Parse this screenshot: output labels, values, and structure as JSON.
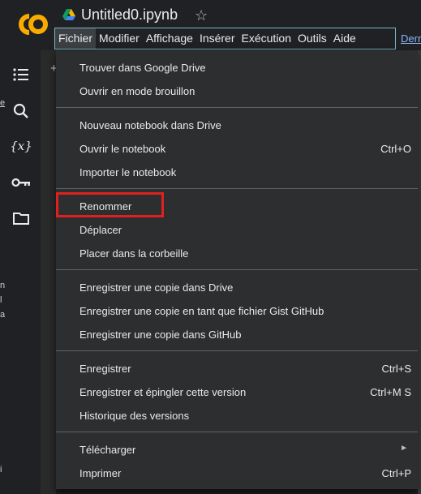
{
  "app": {
    "logo_text": "CO",
    "title": "Untitled0.ipynb",
    "star": "☆"
  },
  "menubar": {
    "items": [
      "Fichier",
      "Modifier",
      "Affichage",
      "Insérer",
      "Exécution",
      "Outils",
      "Aide"
    ],
    "extra": "Dern"
  },
  "sidebar": {
    "icons": [
      "list-icon",
      "search-icon",
      "variables-icon",
      "key-icon",
      "folder-icon"
    ],
    "variables_glyph": "{x}"
  },
  "edge_fragments": {
    "plus": "+",
    "n": "n",
    "l": "l",
    "a": "a",
    "i": "i",
    "e": "e"
  },
  "file_menu": {
    "items": [
      {
        "label": "Trouver dans Google Drive",
        "shortcut": ""
      },
      {
        "label": "Ouvrir en mode brouillon",
        "shortcut": ""
      },
      {
        "label": "Nouveau notebook dans Drive",
        "shortcut": ""
      },
      {
        "label": "Ouvrir le notebook",
        "shortcut": "Ctrl+O"
      },
      {
        "label": "Importer le notebook",
        "shortcut": ""
      },
      {
        "label": "Renommer",
        "shortcut": ""
      },
      {
        "label": "Déplacer",
        "shortcut": ""
      },
      {
        "label": "Placer dans la corbeille",
        "shortcut": ""
      },
      {
        "label": "Enregistrer une copie dans Drive",
        "shortcut": ""
      },
      {
        "label": "Enregistrer une copie en tant que fichier Gist GitHub",
        "shortcut": ""
      },
      {
        "label": "Enregistrer une copie dans GitHub",
        "shortcut": ""
      },
      {
        "label": "Enregistrer",
        "shortcut": "Ctrl+S"
      },
      {
        "label": "Enregistrer et épingler cette version",
        "shortcut": "Ctrl+M S"
      },
      {
        "label": "Historique des versions",
        "shortcut": ""
      },
      {
        "label": "Télécharger",
        "shortcut": "",
        "submenu_arrow": "►"
      },
      {
        "label": "Imprimer",
        "shortcut": "Ctrl+P"
      }
    ]
  },
  "colors": {
    "logo_orange": "#f9ab00",
    "highlight_red": "#e0201f",
    "menubar_border": "#7ab7c8",
    "link_blue": "#8ab4f8"
  }
}
